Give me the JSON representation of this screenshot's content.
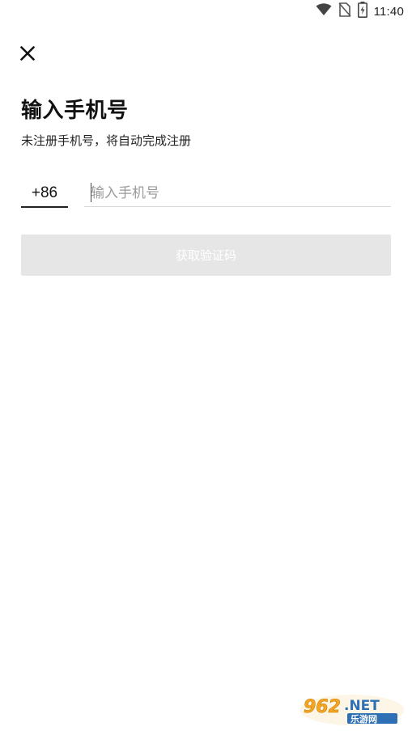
{
  "status_bar": {
    "time": "11:40",
    "icons": [
      "wifi-icon",
      "no-sim-icon",
      "battery-charging-icon"
    ]
  },
  "header": {
    "close_icon": "close-icon"
  },
  "login": {
    "title": "输入手机号",
    "subtitle": "未注册手机号，将自动完成注册",
    "country_code": "+86",
    "phone_placeholder": "输入手机号",
    "phone_value": "",
    "get_code_label": "获取验证码"
  },
  "watermark": {
    "brand": "962.NET",
    "caption": "乐游网"
  },
  "colors": {
    "background": "#ffffff",
    "text": "#111111",
    "placeholder": "#9a9a9a",
    "button_disabled_bg": "#e6e6e6",
    "button_disabled_text": "#ffffff",
    "watermark_orange": "#f5a623",
    "watermark_blue": "#2f6fb6"
  }
}
